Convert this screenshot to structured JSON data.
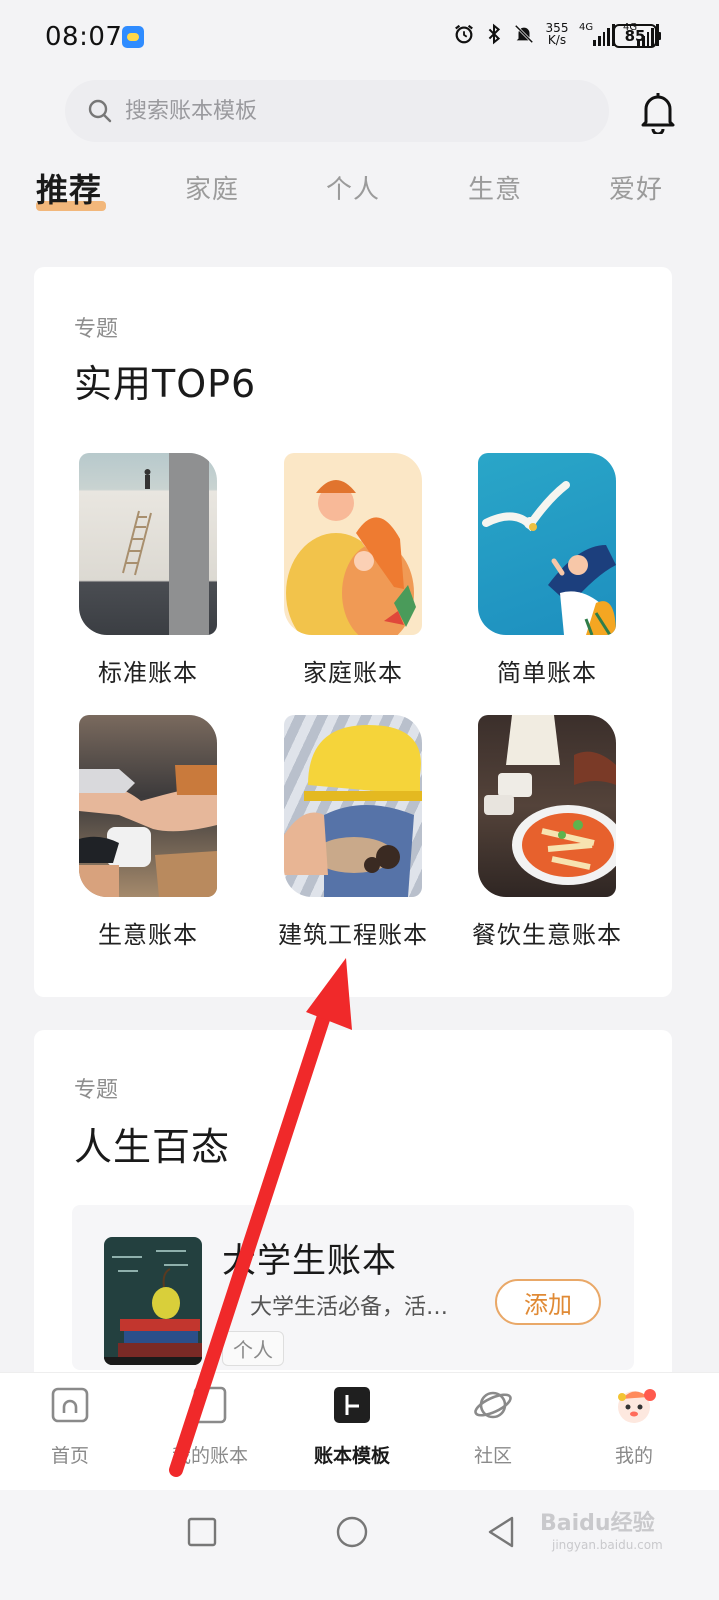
{
  "status_bar": {
    "time": "08:07",
    "net_speed_value": "355",
    "net_speed_unit": "K/s",
    "sim1": "4G",
    "sim2": "4G",
    "battery": "85"
  },
  "search": {
    "placeholder": "搜索账本模板"
  },
  "tabs": [
    {
      "label": "推荐",
      "active": true
    },
    {
      "label": "家庭"
    },
    {
      "label": "个人"
    },
    {
      "label": "生意"
    },
    {
      "label": "爱好"
    }
  ],
  "section_top6": {
    "eyebrow": "专题",
    "title": "实用TOP6",
    "items": [
      {
        "label": "标准账本",
        "icon": "ladder-wall-image"
      },
      {
        "label": "家庭账本",
        "icon": "family-hug-image"
      },
      {
        "label": "简单账本",
        "icon": "seagull-girl-image"
      },
      {
        "label": "生意账本",
        "icon": "handshake-image"
      },
      {
        "label": "建筑工程账本",
        "icon": "hard-hat-image"
      },
      {
        "label": "餐饮生意账本",
        "icon": "food-dish-image"
      }
    ]
  },
  "section_life": {
    "eyebrow": "专题",
    "title": "人生百态",
    "item": {
      "title": "大学生账本",
      "desc": "大学生活必备，活…",
      "tag": "个人",
      "add_label": "添加"
    }
  },
  "bottom_nav": [
    {
      "label": "首页",
      "icon": "home-icon"
    },
    {
      "label": "我的账本",
      "icon": "ledger-icon"
    },
    {
      "label": "账本模板",
      "icon": "template-icon",
      "active": true
    },
    {
      "label": "社区",
      "icon": "planet-icon"
    },
    {
      "label": "我的",
      "icon": "mascot-avatar-icon"
    }
  ],
  "watermark": {
    "brand": "Baidu经验",
    "url": "jingyan.baidu.com"
  },
  "colors": {
    "accent": "#e08a35",
    "annotation": "#f0292a",
    "tab_underline": "#f2b06e"
  }
}
